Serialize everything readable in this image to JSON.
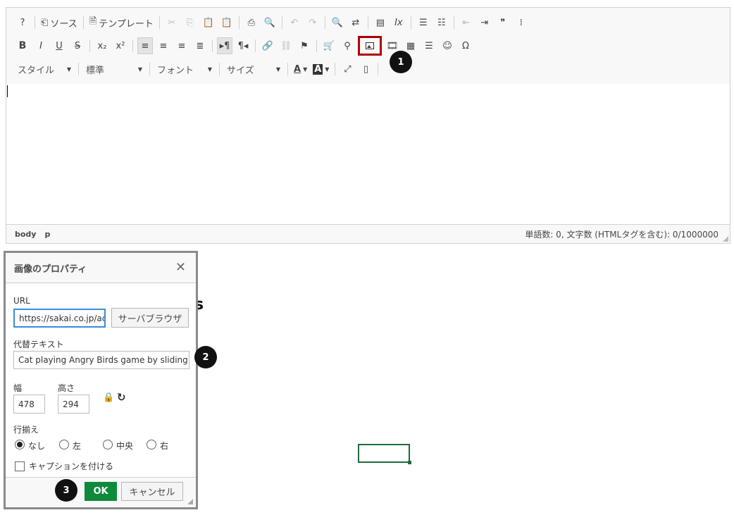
{
  "toolbar": {
    "row1": [
      {
        "name": "help-icon",
        "glyph": "?"
      },
      {
        "sep": true
      },
      {
        "name": "source-button",
        "glyph": "⎗",
        "label": "ソース"
      },
      {
        "sep": true
      },
      {
        "name": "template-button",
        "glyph": "🗎",
        "label": "テンプレート"
      },
      {
        "sep": true
      },
      {
        "name": "cut-icon",
        "glyph": "✂",
        "disabled": true
      },
      {
        "name": "copy-icon",
        "glyph": "⎘",
        "disabled": true
      },
      {
        "name": "paste-icon",
        "glyph": "📋"
      },
      {
        "name": "paste-text-icon",
        "glyph": "📋"
      },
      {
        "sep": true
      },
      {
        "name": "print-icon",
        "glyph": "⎙"
      },
      {
        "name": "preview-icon",
        "glyph": "🔍"
      },
      {
        "sep": true
      },
      {
        "name": "undo-icon",
        "glyph": "↶",
        "disabled": true
      },
      {
        "name": "redo-icon",
        "glyph": "↷",
        "disabled": true
      },
      {
        "sep": true
      },
      {
        "name": "find-icon",
        "glyph": "🔍"
      },
      {
        "name": "replace-icon",
        "glyph": "⇄"
      },
      {
        "sep": true
      },
      {
        "name": "select-all-icon",
        "glyph": "▤"
      },
      {
        "name": "remove-format-icon",
        "glyph": "Ix"
      },
      {
        "sep": true
      },
      {
        "name": "numbered-list-icon",
        "glyph": "☰"
      },
      {
        "name": "bulleted-list-icon",
        "glyph": "☷"
      },
      {
        "sep": true
      },
      {
        "name": "outdent-icon",
        "glyph": "⇤",
        "disabled": true
      },
      {
        "name": "indent-icon",
        "glyph": "⇥"
      },
      {
        "name": "blockquote-icon",
        "glyph": "❞"
      },
      {
        "name": "div-icon",
        "glyph": "⁞"
      }
    ],
    "row2": [
      {
        "name": "bold-icon",
        "glyph": "B",
        "bold": true
      },
      {
        "name": "italic-icon",
        "glyph": "I"
      },
      {
        "name": "underline-icon",
        "glyph": "U"
      },
      {
        "name": "strikethrough-icon",
        "glyph": "S"
      },
      {
        "sep": true
      },
      {
        "name": "subscript-icon",
        "glyph": "x₂"
      },
      {
        "name": "superscript-icon",
        "glyph": "x²"
      },
      {
        "sep": true
      },
      {
        "name": "align-left-icon",
        "glyph": "≡",
        "active": true
      },
      {
        "name": "align-center-icon",
        "glyph": "≡"
      },
      {
        "name": "align-right-icon",
        "glyph": "≡"
      },
      {
        "name": "align-justify-icon",
        "glyph": "≣"
      },
      {
        "sep": true
      },
      {
        "name": "ltr-icon",
        "glyph": "▸¶",
        "active": true
      },
      {
        "name": "rtl-icon",
        "glyph": "¶◂"
      },
      {
        "sep": true
      },
      {
        "name": "link-icon",
        "glyph": "🔗"
      },
      {
        "name": "unlink-icon",
        "glyph": "⛓",
        "disabled": true
      },
      {
        "name": "anchor-flag-icon",
        "glyph": "⚑"
      },
      {
        "sep": true
      },
      {
        "name": "cart-icon",
        "glyph": "🛒"
      },
      {
        "name": "pin-icon",
        "glyph": "⚲"
      },
      {
        "name": "image-icon",
        "glyph": "",
        "highlight": true
      },
      {
        "name": "video-icon",
        "glyph": "🎞"
      },
      {
        "name": "table-icon",
        "glyph": "▦"
      },
      {
        "name": "horizontal-rule-icon",
        "glyph": "☰"
      },
      {
        "name": "smiley-icon",
        "glyph": "☺"
      },
      {
        "name": "omega-icon",
        "glyph": "Ω"
      }
    ],
    "row3": {
      "style_combo": "スタイル",
      "format_combo": "標準",
      "font_combo": "フォント",
      "size_combo": "サイズ",
      "text_color_glyph": "A",
      "bg_color_glyph": "A",
      "maximize_glyph": "⤢",
      "show_blocks_glyph": "▯"
    }
  },
  "statusbar": {
    "path": [
      "body",
      "p"
    ],
    "wordcount": "単語数: 0, 文字数 (HTMLタグを含む): 0/1000000"
  },
  "badges": {
    "b1": "1",
    "b2": "2",
    "b3": "3"
  },
  "dialog": {
    "title": "画像のプロパティ",
    "close": "✕",
    "url_label": "URL",
    "url_value": "https://sakai.co.jp/acc",
    "server_browser": "サーバブラウザ",
    "alt_label": "代替テキスト",
    "alt_value": "Cat playing Angry Birds game by sliding his",
    "width_label": "幅",
    "width_value": "478",
    "height_label": "高さ",
    "height_value": "294",
    "lock_glyph": "🔒",
    "reset_glyph": "↻",
    "align_label": "行揃え",
    "align_options": [
      "なし",
      "左",
      "中央",
      "右"
    ],
    "align_selected": "なし",
    "caption_label": "キャプションを付ける",
    "ok": "OK",
    "cancel": "キャンセル"
  },
  "background": {
    "glyph": "s"
  },
  "colors": {
    "highlight": "#b00000",
    "ok_green": "#0d8a3c",
    "focus_blue": "#3a8be0",
    "cell_border": "#1e6b3c"
  }
}
